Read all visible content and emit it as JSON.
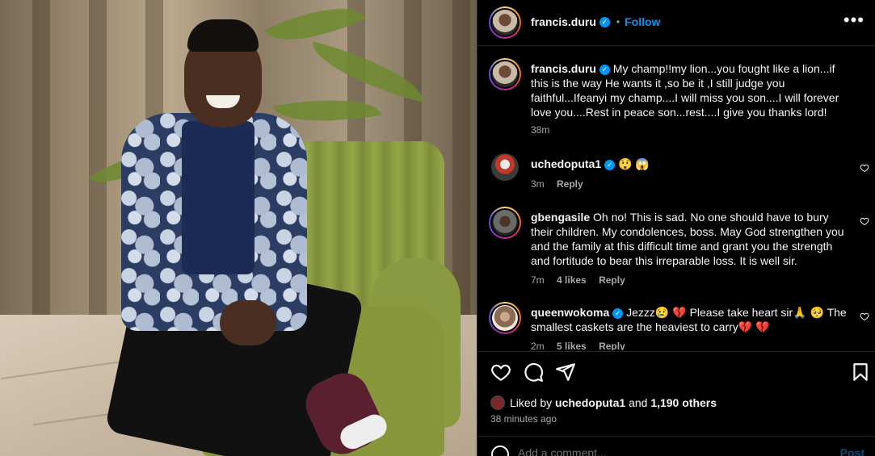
{
  "post_author": {
    "username": "francis.duru",
    "follow_label": "Follow",
    "separator": "•"
  },
  "caption": {
    "username": "francis.duru",
    "text": "My champ!!my lion...you fought like a lion...if this is the way He wants it ,so be it ,I still judge you faithful...Ifeanyi my champ....I will miss you son....I will forever love you....Rest in peace son...rest....I give you thanks lord!",
    "time": "38m"
  },
  "comments": [
    {
      "username": "uchedoputa1",
      "text": "😲 😱",
      "time": "3m",
      "likes": "",
      "reply_label": "Reply"
    },
    {
      "username": "gbengasile",
      "text": "Oh no! This is sad. No one should have to bury their children. My condolences, boss. May God strengthen you and the family at this difficult time and grant you the strength and fortitude to bear this irreparable loss. It is well sir.",
      "time": "7m",
      "likes": "4 likes",
      "reply_label": "Reply"
    },
    {
      "username": "queenwokoma",
      "text": "Jezzz😢 💔  Please take heart sir🙏 🥺 The smallest caskets are the heaviest to carry💔 💔",
      "time": "2m",
      "likes": "5 likes",
      "reply_label": "Reply"
    }
  ],
  "likes_summary": {
    "prefix": "Liked by",
    "user": "uchedoputa1",
    "and": "and",
    "others": "1,190 others"
  },
  "time_ago": "38 minutes ago",
  "add_comment": {
    "placeholder": "Add a comment...",
    "post_label": "Post"
  },
  "icons": {
    "more": "more-options-icon",
    "like": "heart-icon",
    "comment": "comment-icon",
    "share": "share-icon",
    "save": "bookmark-icon",
    "emoji": "emoji-icon"
  },
  "colors": {
    "accent": "#0095f6",
    "background": "#000000",
    "text": "#f5f5f5",
    "muted": "#a8a8a8"
  }
}
